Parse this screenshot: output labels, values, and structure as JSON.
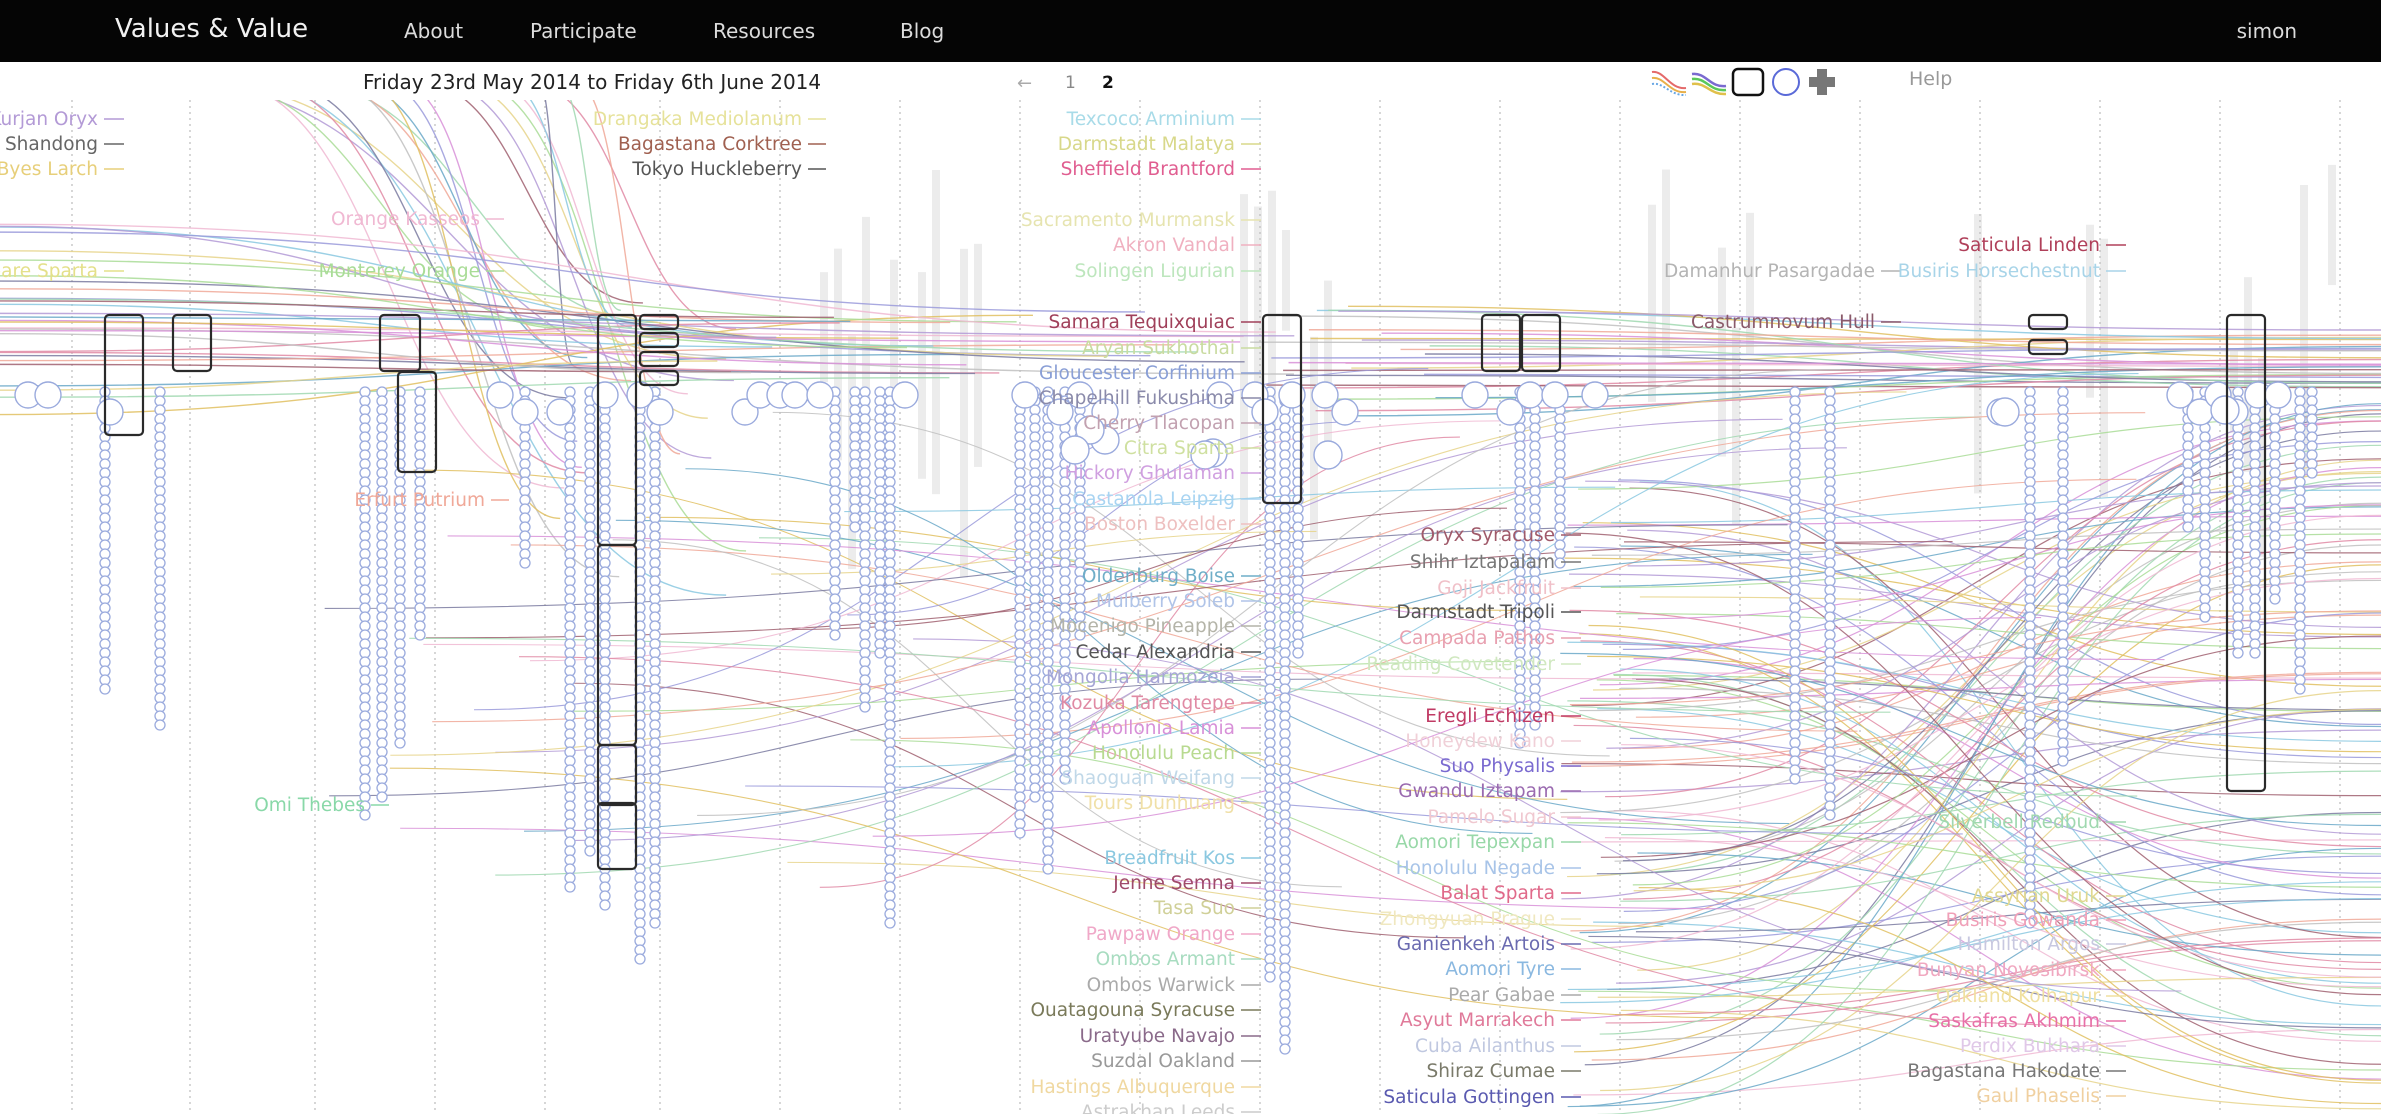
{
  "navbar": {
    "brand": "Values & Value",
    "links": [
      "About",
      "Participate",
      "Resources",
      "Blog"
    ],
    "user": "simon"
  },
  "subbar": {
    "date_range": "Friday 23rd May 2014 to Friday 6th June 2014",
    "pager_prev": "←",
    "pages": [
      "1",
      "2"
    ],
    "current_page": "2",
    "help": "Help"
  },
  "toolbar": {
    "tools": [
      "curves-icon",
      "streams-icon",
      "rect-icon",
      "circle-icon",
      "plus-icon"
    ]
  },
  "viz": {
    "labels_left_edge": [
      {
        "text": "Kurjan Oryx",
        "color": "#b39ad6"
      },
      {
        "text": "Shandong",
        "color": "#666666"
      },
      {
        "text": "Byes Larch",
        "color": "#e7cf7a"
      },
      {
        "text": "Kitapare Sparta",
        "color": "#e4e08a"
      }
    ],
    "labels_col1": [
      {
        "text": "Drangaka Mediolanum",
        "color": "#e6e29a"
      },
      {
        "text": "Bagastana Corktree",
        "color": "#a06050"
      },
      {
        "text": "Tokyo Huckleberry",
        "color": "#555555"
      },
      {
        "text": "Orange Kasseos",
        "color": "#f0b8d2"
      },
      {
        "text": "Monterey Orange",
        "color": "#a9dc97"
      },
      {
        "text": "Erfurt Putrium",
        "color": "#f0a898"
      },
      {
        "text": "Omi Thebes",
        "color": "#89d8a8"
      }
    ],
    "labels_col2": [
      {
        "text": "Texcoco Arminium",
        "color": "#a8dbe8"
      },
      {
        "text": "Darmstadt Malatya",
        "color": "#d8d88a"
      },
      {
        "text": "Sheffield Brantford",
        "color": "#e05d90"
      },
      {
        "text": "Sacramento Murmansk",
        "color": "#e6e4b0"
      },
      {
        "text": "Akron Vandal",
        "color": "#f0b0c0"
      },
      {
        "text": "Solingen Ligurian",
        "color": "#bde6bd"
      },
      {
        "text": "Samara Tequixquiac",
        "color": "#a0405a"
      },
      {
        "text": "Aryan Sukhothai",
        "color": "#c9dba0"
      },
      {
        "text": "Gloucester Corfinium",
        "color": "#8a9fd6"
      },
      {
        "text": "Chapelhill Fukushima",
        "color": "#8a8aaa"
      },
      {
        "text": "Cherry Tlacopan",
        "color": "#c2a1b0"
      },
      {
        "text": "Citra Sparta",
        "color": "#cfe0a0"
      },
      {
        "text": "Hickory Ghulaman",
        "color": "#d0a0e0"
      },
      {
        "text": "Castanola Leipzig",
        "color": "#a8d4f2"
      },
      {
        "text": "Boston Boxelder",
        "color": "#eec0c0"
      },
      {
        "text": "Oldenburg Boise",
        "color": "#6faec8"
      },
      {
        "text": "Mulberry Soleb",
        "color": "#b0c4e8"
      },
      {
        "text": "Mocenigo Pineapple",
        "color": "#b4b4a8"
      },
      {
        "text": "Cedar Alexandria",
        "color": "#555555"
      },
      {
        "text": "Mongolia Harmozeia",
        "color": "#a6a6d6"
      },
      {
        "text": "Kozuka Tarengtepe",
        "color": "#e08aa4"
      },
      {
        "text": "Apollonia Lamia",
        "color": "#d890d8"
      },
      {
        "text": "Honolulu Peach",
        "color": "#b8da90"
      },
      {
        "text": "Shaoguan Weifang",
        "color": "#c0d8e8"
      },
      {
        "text": "Tours Dunhuang",
        "color": "#f0e0a8"
      },
      {
        "text": "Breadfruit Kos",
        "color": "#8ac8e0"
      },
      {
        "text": "Jenne Semna",
        "color": "#a04a6a"
      },
      {
        "text": "Tasa Suo",
        "color": "#d0d098"
      },
      {
        "text": "Pawpaw Orange",
        "color": "#f0a8c8"
      },
      {
        "text": "Ombos Armant",
        "color": "#a8dcc0"
      },
      {
        "text": "Ombos Warwick",
        "color": "#aaaaaa"
      },
      {
        "text": "Ouatagouna Syracuse",
        "color": "#7a7a5a"
      },
      {
        "text": "Uratyube Navajo",
        "color": "#8a6a8a"
      },
      {
        "text": "Suzdal Oakland",
        "color": "#999999"
      },
      {
        "text": "Hastings Albuquerque",
        "color": "#f0d8a0"
      },
      {
        "text": "Astrakhan Leeds",
        "color": "#cccccc"
      }
    ],
    "labels_col3": [
      {
        "text": "Oryx Syracuse",
        "color": "#a05a6a"
      },
      {
        "text": "Shihr Iztapalam",
        "color": "#777777"
      },
      {
        "text": "Goji Jackfruit",
        "color": "#f0c0c8"
      },
      {
        "text": "Darmstadt Tripoli",
        "color": "#555555"
      },
      {
        "text": "Campada Pathos",
        "color": "#e8a0b0"
      },
      {
        "text": "Reading Covetender",
        "color": "#d0e8c0"
      },
      {
        "text": "Eregli Echizen",
        "color": "#c03a64"
      },
      {
        "text": "Honeydew Kano",
        "color": "#f0d0d8"
      },
      {
        "text": "Suo Physalis",
        "color": "#7a6ad0"
      },
      {
        "text": "Gwandu Iztapam",
        "color": "#9a6ab0"
      },
      {
        "text": "Pamelo Sugar",
        "color": "#f0c8d0"
      },
      {
        "text": "Aomori Tepexpan",
        "color": "#98d8a8"
      },
      {
        "text": "Honolulu Negade",
        "color": "#a8c4e8"
      },
      {
        "text": "Balat Sparta",
        "color": "#e06a8a"
      },
      {
        "text": "Zhongyuan Prague",
        "color": "#f0e8c0"
      },
      {
        "text": "Ganienkeh Artois",
        "color": "#6a6ab0"
      },
      {
        "text": "Aomori Tyre",
        "color": "#8ab8e0"
      },
      {
        "text": "Pear Gabae",
        "color": "#aaaaaa"
      },
      {
        "text": "Asyut Marrakech",
        "color": "#e07a9a"
      },
      {
        "text": "Cuba Ailanthus",
        "color": "#c0c8e0"
      },
      {
        "text": "Shiraz Cumae",
        "color": "#7a7a6a"
      },
      {
        "text": "Saticula Gottingen",
        "color": "#5a5ab0"
      }
    ],
    "labels_col4": [
      {
        "text": "Damanhur Pasargadae",
        "color": "#b4b4b4"
      },
      {
        "text": "Castrumnovum Hull",
        "color": "#8a5a6a"
      }
    ],
    "labels_col5": [
      {
        "text": "Saticula Linden",
        "color": "#b0405a"
      },
      {
        "text": "Busiris Horsechestnut",
        "color": "#a8d4e8"
      },
      {
        "text": "Silverbell Redbud",
        "color": "#a0d8b0"
      },
      {
        "text": "Assyrian Uruk",
        "color": "#e0d890"
      },
      {
        "text": "Busiris Gowanda",
        "color": "#f0a0b8"
      },
      {
        "text": "Hamilton Argos",
        "color": "#c8c8e0"
      },
      {
        "text": "Bunyan Novosibirsk",
        "color": "#f0a8c0"
      },
      {
        "text": "Oakland Kolhapur",
        "color": "#f0e0a0"
      },
      {
        "text": "Saskafras Akhmim",
        "color": "#e870a8"
      },
      {
        "text": "Perdix Bukhara",
        "color": "#e0c8e8"
      },
      {
        "text": "Bagastana Hakodate",
        "color": "#777777"
      },
      {
        "text": "Gaul Phaselis",
        "color": "#f0d0a0"
      }
    ]
  }
}
